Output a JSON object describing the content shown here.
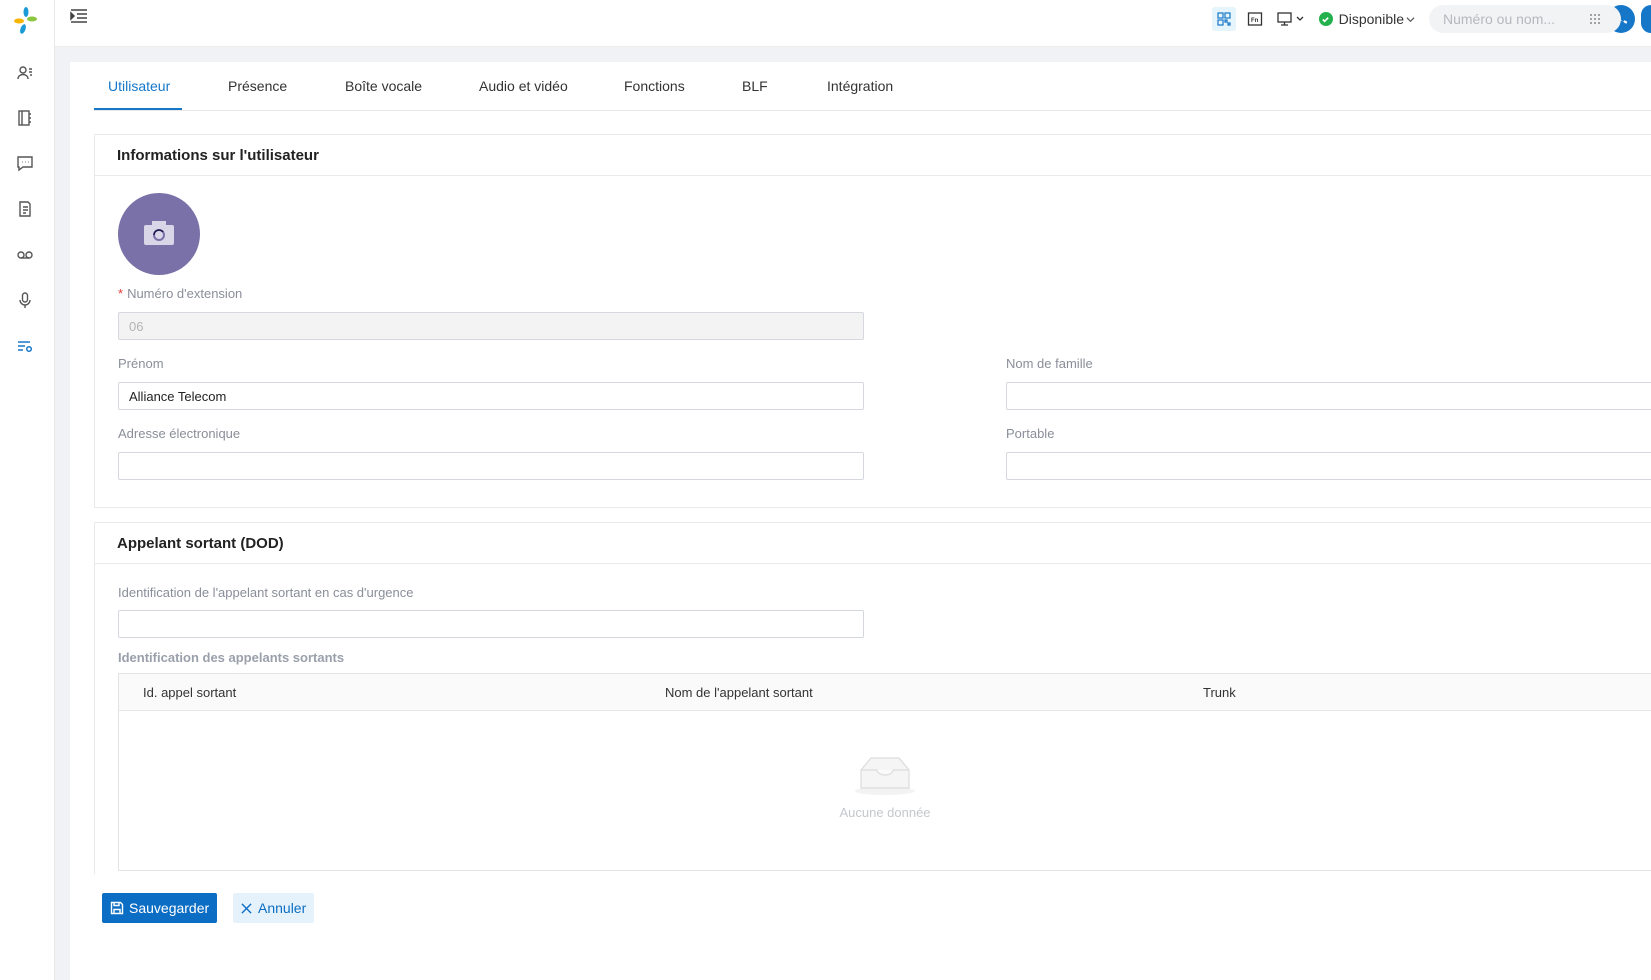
{
  "sidebar": {
    "logo": "yeastar-logo",
    "items": [
      {
        "icon": "contacts-icon"
      },
      {
        "icon": "phonebook-icon"
      },
      {
        "icon": "chat-icon"
      },
      {
        "icon": "call-log-icon"
      },
      {
        "icon": "voicemail-icon"
      },
      {
        "icon": "microphone-icon"
      },
      {
        "icon": "settings-list-icon"
      }
    ]
  },
  "topbar": {
    "status_label": "Disponible",
    "search_placeholder": "Numéro ou nom...",
    "colors": {
      "accent": "#1677c8",
      "status": "#23b14d"
    }
  },
  "tabs": [
    {
      "label": "Utilisateur",
      "active": true
    },
    {
      "label": "Présence"
    },
    {
      "label": "Boîte vocale"
    },
    {
      "label": "Audio et vidéo"
    },
    {
      "label": "Fonctions"
    },
    {
      "label": "BLF"
    },
    {
      "label": "Intégration"
    }
  ],
  "user_info": {
    "title": "Informations sur l'utilisateur",
    "extension_label": "Numéro d'extension",
    "extension_value": "06",
    "first_name_label": "Prénom",
    "first_name_value": "Alliance Telecom",
    "last_name_label": "Nom de famille",
    "last_name_value": "",
    "email_label": "Adresse électronique",
    "email_value": "",
    "mobile_label": "Portable",
    "mobile_value": ""
  },
  "dod": {
    "title": "Appelant sortant (DOD)",
    "emergency_label": "Identification de l'appelant sortant en cas d'urgence",
    "emergency_value": "",
    "ids_label": "Identification des appelants sortants",
    "columns": [
      "Id. appel sortant",
      "Nom de l'appelant sortant",
      "Trunk"
    ],
    "rows": [],
    "empty_text": "Aucune donnée"
  },
  "footer": {
    "save_label": "Sauvegarder",
    "cancel_label": "Annuler"
  }
}
